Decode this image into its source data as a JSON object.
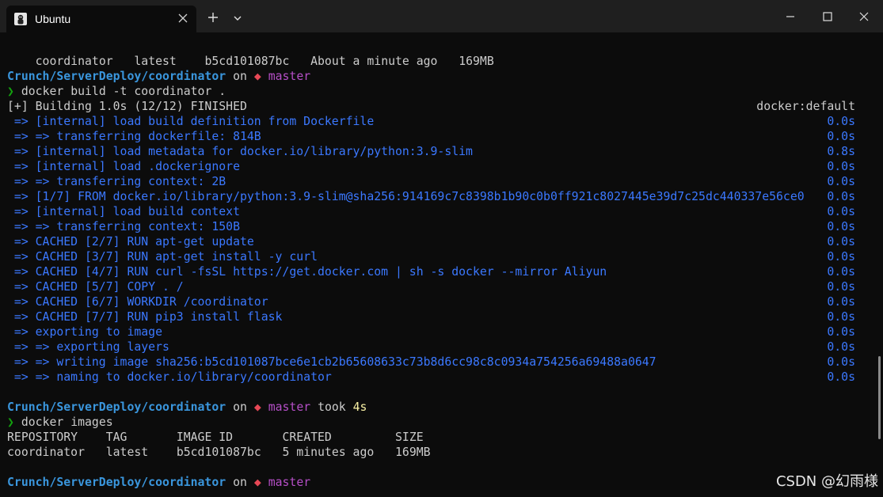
{
  "window": {
    "tab_title": "Ubuntu",
    "icons": [
      "linux-icon",
      "close-icon",
      "plus-icon",
      "chevron-down-icon",
      "minimize-icon",
      "maximize-icon",
      "window-close-icon"
    ]
  },
  "terminal": {
    "top_row": [
      "coordinator",
      "latest",
      "b5cd101087bc",
      "About a minute ago",
      "169MB"
    ],
    "prompt1": {
      "path": "Crunch/ServerDeploy/coordinator",
      "on": "on",
      "git": "",
      "branch": "master"
    },
    "command1": "docker build -t coordinator .",
    "build_header": {
      "left": "[+] Building 1.0s (12/12) FINISHED",
      "right": "docker:default"
    },
    "build_lines": [
      {
        "text": " => [internal] load build definition from Dockerfile",
        "time": "0.0s"
      },
      {
        "text": " => => transferring dockerfile: 814B",
        "time": "0.0s"
      },
      {
        "text": " => [internal] load metadata for docker.io/library/python:3.9-slim",
        "time": "0.8s"
      },
      {
        "text": " => [internal] load .dockerignore",
        "time": "0.0s"
      },
      {
        "text": " => => transferring context: 2B",
        "time": "0.0s"
      },
      {
        "text": " => [1/7] FROM docker.io/library/python:3.9-slim@sha256:914169c7c8398b1b90c0b0ff921c8027445e39d7c25dc440337e56ce0",
        "time": "0.0s"
      },
      {
        "text": " => [internal] load build context",
        "time": "0.0s"
      },
      {
        "text": " => => transferring context: 150B",
        "time": "0.0s"
      },
      {
        "text": " => CACHED [2/7] RUN apt-get update",
        "time": "0.0s"
      },
      {
        "text": " => CACHED [3/7] RUN apt-get install -y curl",
        "time": "0.0s"
      },
      {
        "text": " => CACHED [4/7] RUN curl -fsSL https://get.docker.com | sh -s docker --mirror Aliyun",
        "time": "0.0s"
      },
      {
        "text": " => CACHED [5/7] COPY . /",
        "time": "0.0s"
      },
      {
        "text": " => CACHED [6/7] WORKDIR /coordinator",
        "time": "0.0s"
      },
      {
        "text": " => CACHED [7/7] RUN pip3 install flask",
        "time": "0.0s"
      },
      {
        "text": " => exporting to image",
        "time": "0.0s"
      },
      {
        "text": " => => exporting layers",
        "time": "0.0s"
      },
      {
        "text": " => => writing image sha256:b5cd101087bce6e1cb2b65608633c73b8d6cc98c8c0934a754256a69488a0647",
        "time": "0.0s"
      },
      {
        "text": " => => naming to docker.io/library/coordinator",
        "time": "0.0s"
      }
    ],
    "prompt2": {
      "path": "Crunch/ServerDeploy/coordinator",
      "on": "on",
      "git": "",
      "branch": "master",
      "took": "took",
      "took_value": "4s"
    },
    "command2": "docker images",
    "images_header": [
      "REPOSITORY",
      "TAG",
      "IMAGE ID",
      "CREATED",
      "SIZE"
    ],
    "images_row": [
      "coordinator",
      "latest",
      "b5cd101087bc",
      "5 minutes ago",
      "169MB"
    ],
    "prompt3": {
      "path": "Crunch/ServerDeploy/coordinator",
      "on": "on",
      "git": "",
      "branch": "master"
    },
    "prompt_symbol": "❯"
  },
  "watermark": "CSDN @幻雨様"
}
